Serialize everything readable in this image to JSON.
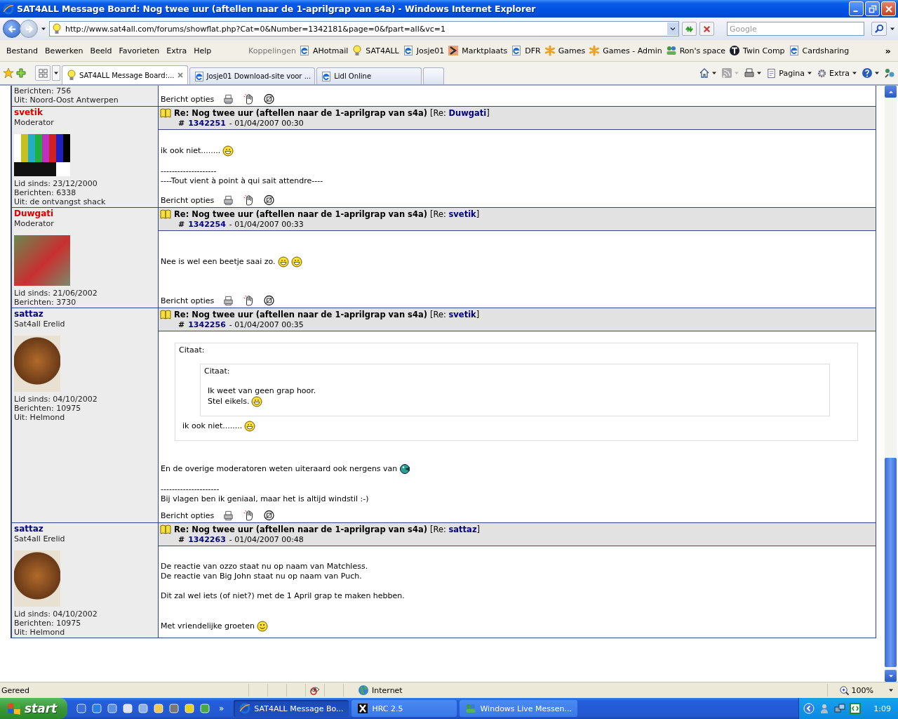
{
  "window": {
    "title": "SAT4ALL Message Board: Nog twee uur (aftellen naar de 1-aprilgrap van s4a) - Windows Internet Explorer"
  },
  "address_bar": {
    "url": "http://www.sat4all.com/forums/showflat.php?Cat=0&Number=1342181&page=0&fpart=all&vc=1"
  },
  "search": {
    "placeholder": "Google"
  },
  "menu": [
    "Bestand",
    "Bewerken",
    "Beeld",
    "Favorieten",
    "Extra",
    "Help"
  ],
  "links": {
    "label": "Koppelingen",
    "more": "»",
    "items": [
      {
        "label": "AHotmail",
        "kind": "page"
      },
      {
        "label": "SAT4ALL",
        "kind": "bulb"
      },
      {
        "label": "Josje01",
        "kind": "page"
      },
      {
        "label": "Marktplaats",
        "kind": "sigma"
      },
      {
        "label": "DFR",
        "kind": "page"
      },
      {
        "label": "Games",
        "kind": "asterisk"
      },
      {
        "label": "Games - Admin",
        "kind": "asterisk"
      },
      {
        "label": "Ron's space",
        "kind": "people"
      },
      {
        "label": "Twin Comp",
        "kind": "round"
      },
      {
        "label": "Cardsharing",
        "kind": "page"
      }
    ]
  },
  "tabs": [
    {
      "label": "SAT4ALL Message Board:...",
      "kind": "bulb",
      "selected": true
    },
    {
      "label": "Josje01 Download-site voor ...",
      "kind": "page",
      "selected": false
    },
    {
      "label": "Lidl Online",
      "kind": "page",
      "selected": false
    }
  ],
  "command_bar": {
    "page": "Pagina",
    "tools": "Extra"
  },
  "forum": {
    "partial_post": {
      "lines": [
        "Berichten: 756",
        "Uit: Noord-Oost Antwerpen"
      ],
      "options": "Bericht opties"
    },
    "posts": [
      {
        "author": "svetik",
        "color": "#dd0000",
        "role": "Moderator",
        "avatar": {
          "kind": "testcard"
        },
        "details": [
          "Lid sinds: 23/12/2000",
          "Berichten: 6338",
          "Uit: de ontvangst shack"
        ],
        "title": "Re: Nog twee uur (aftellen naar de 1-aprilgrap van s4a)",
        "reply_open": "[Re:",
        "reply_to": "Duwgati",
        "reply_close": "]",
        "hash": "#",
        "number": "1342251",
        "date": "- 01/04/2007 00:30",
        "body": [
          {
            "kind": "gap"
          },
          {
            "kind": "line",
            "text": "ik ook niet........",
            "icons": [
              {
                "kind": "grin"
              }
            ]
          },
          {
            "kind": "gap"
          },
          {
            "kind": "line",
            "text": "--------------------"
          },
          {
            "kind": "line",
            "text": "----Tout vient à point à qui sait attendre----"
          }
        ],
        "options": "Bericht opties"
      },
      {
        "author": "Duwgati",
        "color": "#dd0000",
        "role": "Moderator",
        "avatar": {
          "kind": "photo"
        },
        "details": [
          "Lid sinds: 21/06/2002",
          "Berichten: 3730"
        ],
        "title": "Re: Nog twee uur (aftellen naar de 1-aprilgrap van s4a)",
        "reply_open": "[Re:",
        "reply_to": "svetik",
        "reply_close": "]",
        "hash": "#",
        "number": "1342254",
        "date": "- 01/04/2007 00:33",
        "body": [
          {
            "kind": "gap"
          },
          {
            "kind": "gap"
          },
          {
            "kind": "line",
            "text": "Nee is wel een beetje saai zo.",
            "icons": [
              {
                "kind": "grin"
              },
              {
                "kind": "grin"
              }
            ]
          }
        ],
        "options": "Bericht opties"
      },
      {
        "author": "sattaz",
        "color": "#000080",
        "role": "Sat4all Erelid",
        "avatar": {
          "kind": "cartoon"
        },
        "details": [
          "Lid sinds: 04/10/2002",
          "Berichten: 10975",
          "Uit: Helmond"
        ],
        "title": "Re: Nog twee uur (aftellen naar de 1-aprilgrap van s4a)",
        "reply_open": "[Re:",
        "reply_to": "svetik",
        "reply_close": "]",
        "hash": "#",
        "number": "1342256",
        "date": "- 01/04/2007 00:35",
        "body": [
          {
            "kind": "quote",
            "label": "Citaat:",
            "children": [
              {
                "kind": "quote",
                "label": "Citaat:",
                "children": [
                  {
                    "kind": "line",
                    "text": "Ik weet van geen grap hoor."
                  },
                  {
                    "kind": "line",
                    "text": "Stel eikels.",
                    "icons": [
                      {
                        "kind": "grin"
                      }
                    ]
                  }
                ]
              },
              {
                "kind": "line",
                "text": "ik ook niet........",
                "icons": [
                  {
                    "kind": "grin"
                  }
                ]
              }
            ]
          },
          {
            "kind": "gap"
          },
          {
            "kind": "gap"
          },
          {
            "kind": "line",
            "text": "En de overige moderatoren weten uiteraard ook nergens van",
            "icons": [
              {
                "kind": "fish"
              }
            ]
          },
          {
            "kind": "gap"
          },
          {
            "kind": "line",
            "text": "---------------------"
          },
          {
            "kind": "line",
            "text": "Bij vlagen ben ik geniaal, maar het is altijd windstil :-)"
          }
        ],
        "options": "Bericht opties"
      },
      {
        "author": "sattaz",
        "color": "#000080",
        "role": "Sat4all Erelid",
        "avatar": {
          "kind": "cartoon"
        },
        "details": [
          "Lid sinds: 04/10/2002",
          "Berichten: 10975",
          "Uit: Helmond"
        ],
        "title": "Re: Nog twee uur (aftellen naar de 1-aprilgrap van s4a)",
        "reply_open": "[Re:",
        "reply_to": "sattaz",
        "reply_close": "]",
        "hash": "#",
        "number": "1342263",
        "date": "- 01/04/2007 00:48",
        "body": [
          {
            "kind": "gap"
          },
          {
            "kind": "line",
            "text": "De reactie van ozzo staat nu op naam van Matchless."
          },
          {
            "kind": "line",
            "text": "De reactie van Big John staat nu op naam van Puch."
          },
          {
            "kind": "gap"
          },
          {
            "kind": "line",
            "text": "Dit zal wel iets (of niet?) met de 1 April grap te maken hebben."
          },
          {
            "kind": "gap"
          },
          {
            "kind": "gap"
          },
          {
            "kind": "line",
            "text": "Met vriendelijke groeten",
            "icons": [
              {
                "kind": "smile"
              }
            ]
          }
        ]
      }
    ]
  },
  "status_bar": {
    "text": "Gereed",
    "zone": "Internet",
    "zoom": "100%"
  },
  "taskbar": {
    "start": "start",
    "more": "»",
    "tasks": [
      {
        "label": "SAT4ALL Message Bo...",
        "kind": "ie",
        "selected": true
      },
      {
        "label": "HRC 2.5",
        "kind": "x",
        "selected": false
      },
      {
        "label": "Windows Live Messen...",
        "kind": "people",
        "selected": false
      }
    ],
    "clock": "1:09"
  }
}
